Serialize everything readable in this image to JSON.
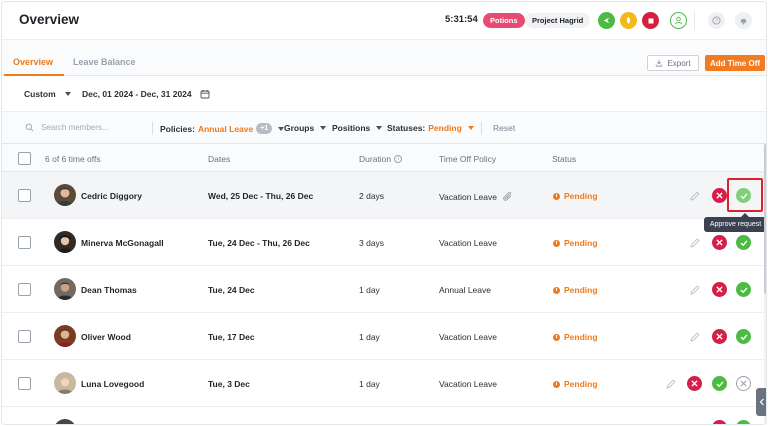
{
  "header": {
    "title": "Overview",
    "timer": "5:31:54",
    "chip_potions": "Potions",
    "chip_project": "Project Hagrid"
  },
  "tabs": [
    {
      "label": "Overview",
      "active": true
    },
    {
      "label": "Leave Balance",
      "active": false
    }
  ],
  "actions": {
    "export_label": "Export",
    "add_label": "Add Time Off"
  },
  "range": {
    "preset": "Custom",
    "dates": "Dec, 01 2024 - Dec, 31 2024"
  },
  "filters": {
    "search_placeholder": "Search members...",
    "policies_label": "Policies:",
    "policies_value": "Annual Leave",
    "policies_badge": "+1",
    "groups_label": "Groups",
    "positions_label": "Positions",
    "statuses_label": "Statuses:",
    "statuses_value": "Pending",
    "reset_label": "Reset"
  },
  "table": {
    "count_label": "6 of 6 time offs",
    "col_dates": "Dates",
    "col_duration": "Duration",
    "col_policy": "Time Off Policy",
    "col_status": "Status",
    "rows": [
      {
        "name": "Cedric Diggory",
        "dates": "Wed, 25 Dec - Thu, 26 Dec",
        "duration": "2 days",
        "policy": "Vacation Leave",
        "status": "Pending"
      },
      {
        "name": "Minerva McGonagall",
        "dates": "Tue, 24 Dec - Thu, 26 Dec",
        "duration": "3 days",
        "policy": "Vacation Leave",
        "status": "Pending"
      },
      {
        "name": "Dean Thomas",
        "dates": "Tue, 24 Dec",
        "duration": "1 day",
        "policy": "Annual Leave",
        "status": "Pending"
      },
      {
        "name": "Oliver Wood",
        "dates": "Tue, 17 Dec",
        "duration": "1 day",
        "policy": "Vacation Leave",
        "status": "Pending"
      },
      {
        "name": "Luna Lovegood",
        "dates": "Tue, 3 Dec",
        "duration": "1 day",
        "policy": "Vacation Leave",
        "status": "Pending"
      }
    ]
  },
  "tooltip": "Approve request",
  "colors": {
    "accent": "#f07a1a",
    "approve": "#4cbb43",
    "reject": "#d61e4a",
    "highlight": "#d9232e"
  },
  "icons": [
    "calendar-icon",
    "search-icon",
    "export-icon",
    "paperclip-icon",
    "info-icon",
    "pencil-icon",
    "reject-icon",
    "approve-icon",
    "cancel-icon",
    "timer-play-icon",
    "break-icon",
    "stop-icon",
    "user-icon",
    "help-icon",
    "bell-icon"
  ]
}
